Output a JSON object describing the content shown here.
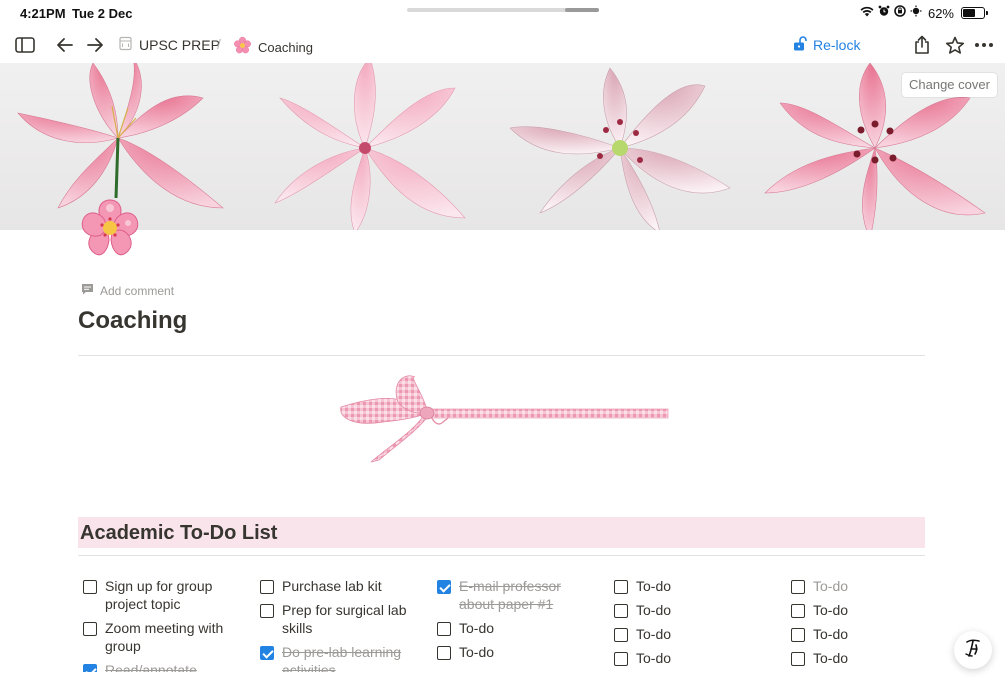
{
  "status_bar": {
    "time": "4:21PM",
    "date": "Tue 2 Dec",
    "battery_percent": "62%",
    "battery_level": 0.62
  },
  "toolbar": {
    "workspace_label": "UPSC PREP",
    "page_label": "Coaching",
    "separator": "/",
    "relock_label": "Re-lock"
  },
  "cover": {
    "change_cover_label": "Change cover"
  },
  "page": {
    "add_comment_label": "Add comment",
    "title": "Coaching",
    "icon": "cherry-blossom-icon"
  },
  "section": {
    "heading": "Academic To-Do List",
    "heading_bg": "#f9e4ec"
  },
  "todo_columns": [
    {
      "items": [
        {
          "text": "Sign up for group project topic",
          "checked": false
        },
        {
          "text": "Zoom meeting with group",
          "checked": false
        },
        {
          "text": "Read/annotate",
          "checked": true
        }
      ]
    },
    {
      "items": [
        {
          "text": "Purchase lab kit",
          "checked": false
        },
        {
          "text": "Prep for surgical lab skills",
          "checked": false
        },
        {
          "text": "Do pre-lab learning activities",
          "checked": true
        }
      ]
    },
    {
      "items": [
        {
          "text": "E-mail professor about paper #1",
          "checked": true
        },
        {
          "text": "To-do",
          "checked": false
        },
        {
          "text": "To-do",
          "checked": false
        }
      ]
    },
    {
      "items": [
        {
          "text": "To-do",
          "checked": false
        },
        {
          "text": "To-do",
          "checked": false
        },
        {
          "text": "To-do",
          "checked": false
        },
        {
          "text": "To-do",
          "checked": false
        }
      ]
    },
    {
      "items": [
        {
          "text": "To-do",
          "checked": false,
          "placeholder": true
        },
        {
          "text": "To-do",
          "checked": false
        },
        {
          "text": "To-do",
          "checked": false
        },
        {
          "text": "To-do",
          "checked": false
        }
      ]
    }
  ],
  "colors": {
    "accent": "#2383e2",
    "text": "#37352f",
    "muted": "#9b9a97"
  }
}
